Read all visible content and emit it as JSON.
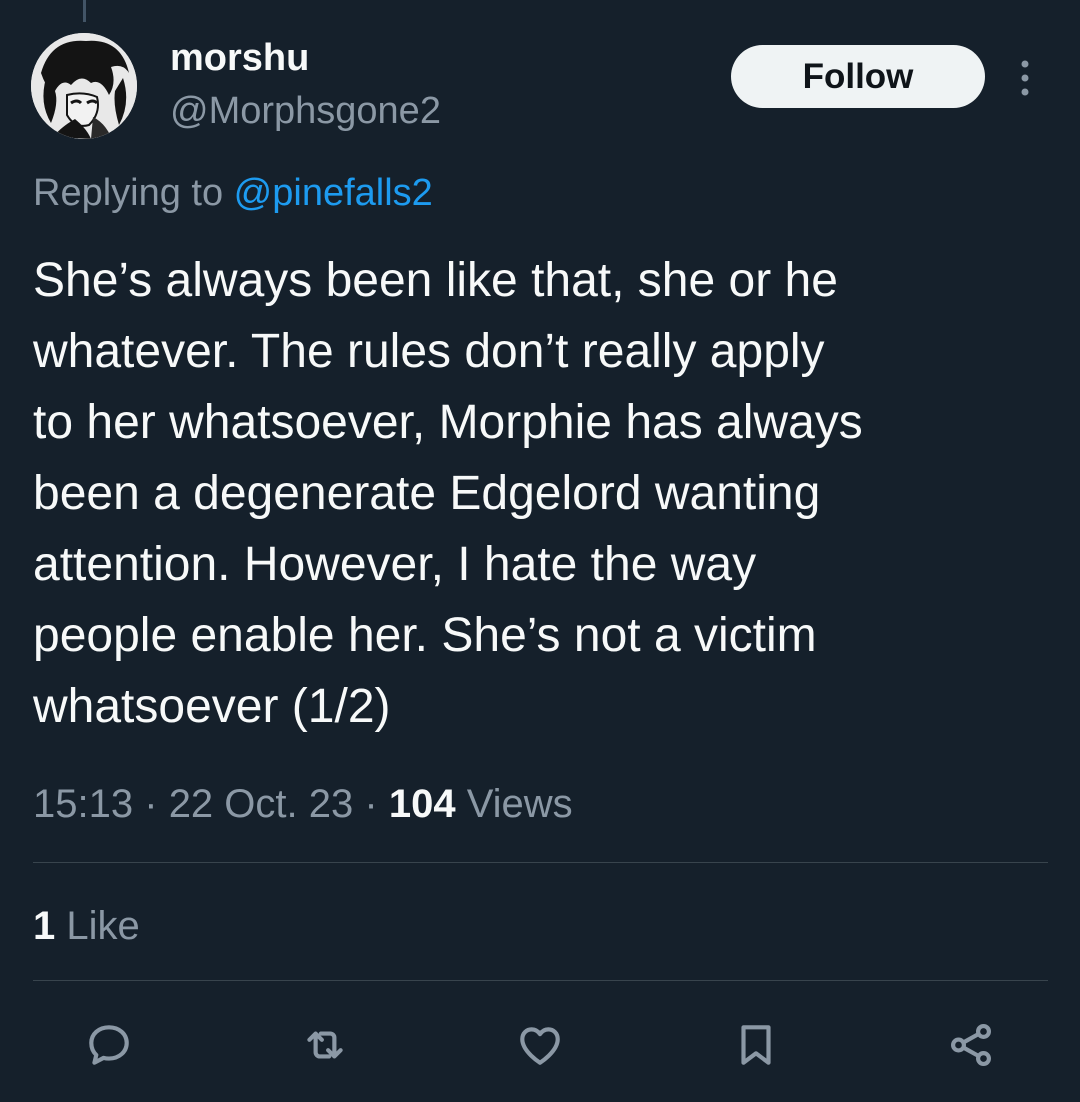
{
  "author": {
    "display_name": "morshu",
    "handle": "@Morphsgone2"
  },
  "follow_label": "Follow",
  "reply_context": {
    "prefix": "Replying to ",
    "mention": "@pinefalls2"
  },
  "tweet": {
    "text": "She’s always been like that, she or he\nwhatever. The rules don’t really apply\nto her whatsoever, Morphie has always\nbeen a degenerate Edgelord wanting\nattention. However, I hate the way\npeople enable her. She’s not a victim\nwhatsoever (1/2)"
  },
  "meta": {
    "time": "15:13",
    "date": "22 Oct. 23",
    "views_count": "104",
    "views_label": "Views",
    "separator": "·"
  },
  "stats": {
    "like_count": "1",
    "like_label": "Like"
  },
  "actions": [
    {
      "icon": "reply-icon"
    },
    {
      "icon": "retweet-icon"
    },
    {
      "icon": "like-heart-icon"
    },
    {
      "icon": "bookmark-icon"
    },
    {
      "icon": "share-icon"
    }
  ],
  "colors": {
    "background": "#15202b",
    "text_primary": "#f7f9f9",
    "text_secondary": "#8b98a5",
    "accent": "#1d9bf0",
    "divider": "#38444d"
  }
}
